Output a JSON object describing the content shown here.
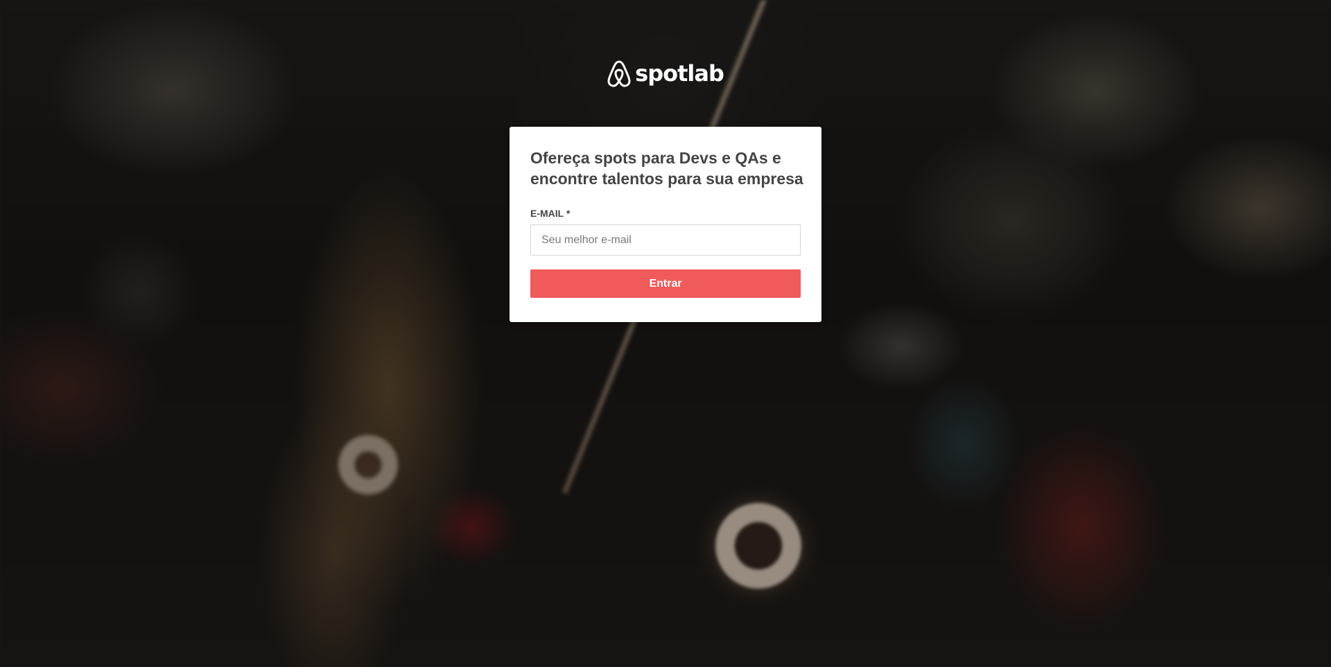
{
  "brand": {
    "name": "spotlab",
    "logo_icon": "airbnb-belo-icon",
    "color": "#ffffff"
  },
  "card": {
    "title": "Ofereça spots para Devs e QAs e encontre talentos para sua empresa",
    "email_label": "E-MAIL *",
    "email_placeholder": "Seu melhor e-mail",
    "email_value": "",
    "submit_label": "Entrar"
  },
  "colors": {
    "accent": "#f05a5b",
    "card_background": "#ffffff",
    "title_text": "#444444"
  }
}
